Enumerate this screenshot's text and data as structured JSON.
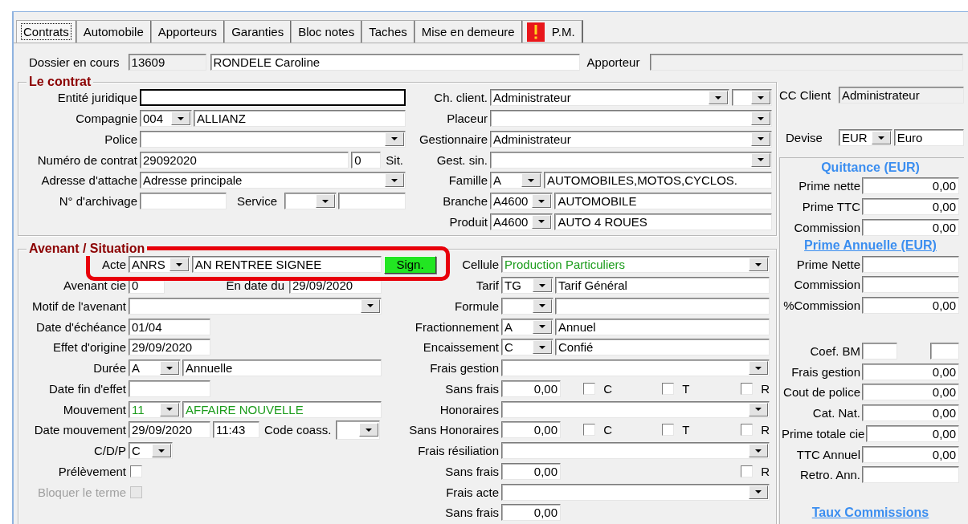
{
  "tabs": [
    {
      "label": "Contrats",
      "selected": true
    },
    {
      "label": "Automobile",
      "selected": false
    },
    {
      "label": "Apporteurs",
      "selected": false
    },
    {
      "label": "Garanties",
      "selected": false
    },
    {
      "label": "Bloc notes",
      "selected": false
    },
    {
      "label": "Taches",
      "selected": false
    },
    {
      "label": "Mise en demeure",
      "selected": false
    },
    {
      "label": "P.M.",
      "selected": false,
      "alert": true
    }
  ],
  "dossier": {
    "label": "Dossier en cours",
    "number": "13609",
    "name": "RONDELE Caroline",
    "apporteur_label": "Apporteur"
  },
  "contrat": {
    "title": "Le contrat",
    "left": [
      {
        "kind": "text",
        "label": "Entité juridique",
        "focused": true
      },
      {
        "kind": "combo",
        "label": "Compagnie",
        "code": "004",
        "description": "ALLIANZ"
      },
      {
        "kind": "select",
        "label": "Police"
      },
      {
        "kind": "contract-number",
        "label": "Numéro de contrat",
        "value": "29092020",
        "situation": "0",
        "suffix": "Sit."
      },
      {
        "kind": "select",
        "label": "Adresse d'attache",
        "value": "Adresse principale"
      },
      {
        "kind": "archive",
        "label": "N° d'archivage",
        "service_label": "Service"
      }
    ],
    "middle": [
      {
        "kind": "select-pair",
        "label": "Ch. client.",
        "value": "Administrateur"
      },
      {
        "kind": "select",
        "label": "Placeur"
      },
      {
        "kind": "select",
        "label": "Gestionnaire",
        "value": "Administrateur"
      },
      {
        "kind": "select",
        "label": "Gest. sin."
      },
      {
        "kind": "combo",
        "label": "Famille",
        "code": "A",
        "description": "AUTOMOBILES,MOTOS,CYCLOS."
      },
      {
        "kind": "combo",
        "label": "Branche",
        "code": "A4600",
        "description": "AUTOMOBILE"
      },
      {
        "kind": "combo",
        "label": "Produit",
        "code": "A4600",
        "description": "AUTO 4 ROUES"
      }
    ]
  },
  "avenant": {
    "title": "Avenant / Situation",
    "left": [
      {
        "kind": "combo",
        "label": "Acte",
        "code": "ANRS",
        "description": "AN RENTREE SIGNEE",
        "highlighted": true,
        "button": "Sign."
      },
      {
        "kind": "amendment",
        "label": "Avenant cie",
        "value": "0",
        "date_label": "En date du",
        "date": "29/09/2020"
      },
      {
        "kind": "select",
        "label": "Motif de l'avenant"
      },
      {
        "kind": "short",
        "label": "Date d'échéance",
        "value": "01/04"
      },
      {
        "kind": "short",
        "label": "Effet d'origine",
        "value": "29/09/2020"
      },
      {
        "kind": "combo",
        "label": "Durée",
        "code": "A",
        "description": "Annuelle"
      },
      {
        "kind": "short",
        "label": "Date fin d'effet"
      },
      {
        "kind": "combo",
        "label": "Mouvement",
        "code": "11",
        "description": "AFFAIRE NOUVELLE",
        "color": "#1c9c1c"
      },
      {
        "kind": "movement-date",
        "label": "Date mouvement",
        "value": "29/09/2020",
        "time": "11:43",
        "coass_label": "Code coass."
      },
      {
        "kind": "code-select",
        "label": "C/D/P",
        "code": "C"
      },
      {
        "kind": "checkbox",
        "label": "Prélèvement",
        "checked": false,
        "disabled": false
      },
      {
        "kind": "checkbox",
        "label": "Bloquer le terme",
        "checked": false,
        "disabled": true
      }
    ],
    "middle": [
      {
        "kind": "select",
        "label": "Cellule",
        "value": "Production Particuliers",
        "color": "#1c9c1c"
      },
      {
        "kind": "combo",
        "label": "Tarif",
        "code": "TG",
        "description": "Tarif Général"
      },
      {
        "kind": "combo",
        "label": "Formule"
      },
      {
        "kind": "combo",
        "label": "Fractionnement",
        "code": "A",
        "description": "Annuel"
      },
      {
        "kind": "combo",
        "label": "Encaissement",
        "code": "C",
        "description": "Confié"
      },
      {
        "kind": "select",
        "label": "Frais gestion"
      },
      {
        "kind": "amount",
        "label": "Sans frais",
        "value": "0,00",
        "checks": [
          {
            "label": "C",
            "checked": false
          },
          {
            "label": "T",
            "checked": false
          },
          {
            "label": "R",
            "checked": false
          }
        ]
      },
      {
        "kind": "select",
        "label": "Honoraires"
      },
      {
        "kind": "amount",
        "label": "Sans Honoraires",
        "value": "0,00",
        "checks": [
          {
            "label": "C",
            "checked": false
          },
          {
            "label": "T",
            "checked": false
          },
          {
            "label": "R",
            "checked": false
          }
        ]
      },
      {
        "kind": "select",
        "label": "Frais résiliation"
      },
      {
        "kind": "amount",
        "label": "Sans frais",
        "value": "0,00",
        "checks": [
          {
            "label": "R",
            "checked": false
          }
        ]
      },
      {
        "kind": "select",
        "label": "Frais acte"
      },
      {
        "kind": "amount",
        "label": "Sans frais",
        "value": "0,00"
      }
    ]
  },
  "cc_client": {
    "label": "CC Client",
    "value": "Administrateur"
  },
  "devise": {
    "label": "Devise",
    "code": "EUR",
    "description": "Euro"
  },
  "totals": [
    {
      "title": "Quittance (EUR)",
      "link": false,
      "rows": [
        {
          "kind": "amount",
          "label": "Prime nette",
          "value": "0,00"
        },
        {
          "kind": "amount",
          "label": "Prime TTC",
          "value": "0,00"
        },
        {
          "kind": "amount",
          "label": "Commission",
          "value": "0,00"
        }
      ]
    },
    {
      "title": "Prime Annuelle (EUR)",
      "link": true,
      "rows": [
        {
          "kind": "amount",
          "label": "Prime Nette"
        },
        {
          "kind": "amount",
          "label": "Commission"
        },
        {
          "kind": "amount",
          "label": "%Commission",
          "value": "0,00"
        }
      ]
    },
    {
      "rows": [
        {
          "kind": "pair",
          "label": "Coef. BM"
        },
        {
          "kind": "amount",
          "label": "Frais gestion",
          "value": "0,00"
        },
        {
          "kind": "amount",
          "label": "Cout de police",
          "value": "0,00"
        },
        {
          "kind": "amount",
          "label": "Cat. Nat.",
          "value": "0,00"
        },
        {
          "kind": "amount",
          "label": "Prime totale cie",
          "value": "0,00"
        },
        {
          "kind": "amount",
          "label": "TTC Annuel",
          "value": "0,00"
        },
        {
          "kind": "amount",
          "label": "Retro. Ann."
        }
      ]
    },
    {
      "title": "Taux Commissions",
      "link": true
    }
  ]
}
